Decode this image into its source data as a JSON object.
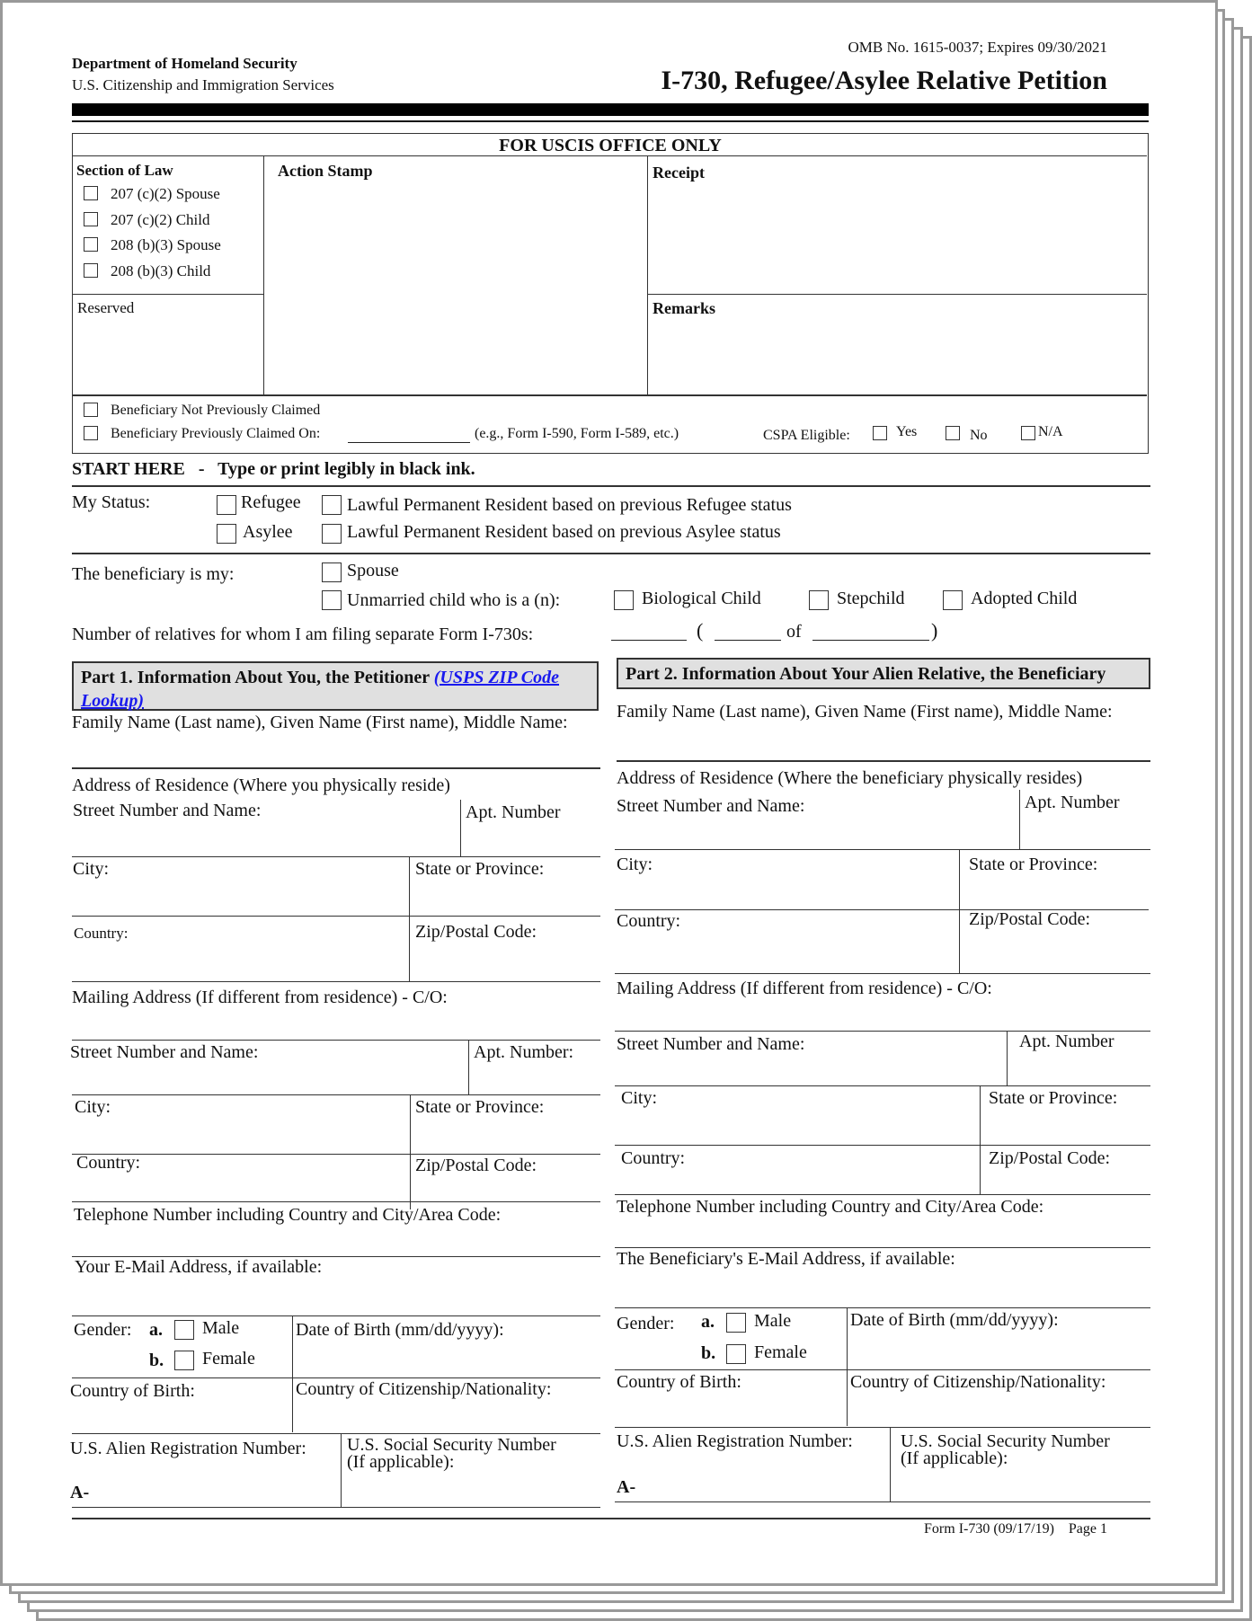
{
  "header": {
    "department": "Department of Homeland Security",
    "agency": "U.S. Citizenship and Immigration Services",
    "omb": "OMB No. 1615-0037; Expires 09/30/2021",
    "title": "I-730, Refugee/Asylee Relative Petition"
  },
  "office_use": {
    "title": "FOR USCIS OFFICE ONLY",
    "section_of_law_label": "Section of Law",
    "section_of_law_options": [
      "207 (c)(2) Spouse",
      "207 (c)(2) Child",
      "208 (b)(3) Spouse",
      "208 (b)(3) Child"
    ],
    "reserved_label": "Reserved",
    "action_stamp_label": "Action Stamp",
    "receipt_label": "Receipt",
    "remarks_label": "Remarks",
    "not_claimed_label": "Beneficiary Not Previously Claimed",
    "claimed_on_label": "Beneficiary Previously Claimed On:",
    "claimed_on_hint": "(e.g., Form I-590, Form I-589, etc.)",
    "cspa_label": "CSPA Eligible:",
    "cspa_options": [
      "Yes",
      "No",
      "N/A"
    ]
  },
  "start_here": {
    "label": "START HERE",
    "dash": "-",
    "instruction": "Type or print legibly in black ink."
  },
  "status": {
    "label": "My Status:",
    "options": [
      "Refugee",
      "Asylee",
      "Lawful Permanent Resident based on previous Refugee status",
      "Lawful Permanent Resident based on previous Asylee status"
    ]
  },
  "beneficiary_relation": {
    "label": "The beneficiary is my:",
    "spouse": "Spouse",
    "unmarried_child": "Unmarried child who is a (n):",
    "child_types": [
      "Biological Child",
      "Stepchild",
      "Adopted Child"
    ],
    "relatives_count_label": "Number of relatives for whom I am filing separate Form I-730s:",
    "open_paren": "(",
    "of": "of",
    "close_paren": ")"
  },
  "part1": {
    "title": "Part 1.  Information About You, the Petitioner ",
    "link": "(USPS ZIP Code Lookup)",
    "name_label": "Family Name (Last name), Given Name (First name), Middle Name:",
    "residence_label": "Address of Residence (Where you physically reside)",
    "street_label": "Street Number and Name:",
    "apt_label": "Apt. Number",
    "city_label": "City:",
    "state_label": "State or Province:",
    "country_label": "Country:",
    "zip_label": "Zip/Postal Code:",
    "mailing_label": "Mailing Address (If different from residence) - C/O:",
    "m_street_label": "Street Number and Name:",
    "m_apt_label": "Apt. Number:",
    "m_city_label": "City:",
    "m_state_label": "State or Province:",
    "m_country_label": "Country:",
    "m_zip_label": "Zip/Postal Code:",
    "phone_label": "Telephone Number including Country and City/Area Code:",
    "email_label": "Your E-Mail Address, if available:",
    "gender_label": "Gender:",
    "gender_a": "a.",
    "gender_b": "b.",
    "male": "Male",
    "female": "Female",
    "dob_label": "Date of Birth (mm/dd/yyyy):",
    "birth_country_label": "Country of Birth:",
    "citizenship_label": "Country of Citizenship/Nationality:",
    "alien_reg_label": "U.S. Alien Registration Number:",
    "alien_prefix": "A-",
    "ssn_label": "U.S. Social Security Number",
    "ssn_note": "(If applicable):"
  },
  "part2": {
    "title": "Part 2.  Information About Your Alien Relative, the Beneficiary",
    "name_label": "Family Name (Last name), Given Name (First name), Middle Name:",
    "residence_label": "Address of Residence (Where the beneficiary physically resides)",
    "street_label": "Street Number and Name:",
    "apt_label": "Apt. Number",
    "city_label": "City:",
    "state_label": "State or Province:",
    "country_label": "Country:",
    "zip_label": "Zip/Postal Code:",
    "mailing_label": "Mailing Address (If different from residence) - C/O:",
    "m_street_label": "Street Number and Name:",
    "m_apt_label": "Apt. Number",
    "m_city_label": "City:",
    "m_state_label": "State or Province:",
    "m_country_label": "Country:",
    "m_zip_label": "Zip/Postal Code:",
    "phone_label": "Telephone Number including Country and City/Area Code:",
    "email_label": "The Beneficiary's E-Mail Address, if available:",
    "gender_label": "Gender:",
    "gender_a": "a.",
    "gender_b": "b.",
    "male": "Male",
    "female": "Female",
    "dob_label": "Date of Birth (mm/dd/yyyy):",
    "birth_country_label": "Country of Birth:",
    "citizenship_label": "Country of Citizenship/Nationality:",
    "alien_reg_label": "U.S. Alien Registration Number:",
    "alien_prefix": "A-",
    "ssn_label": "U.S. Social Security Number",
    "ssn_note": "(If applicable):"
  },
  "footer": {
    "form_id": "Form I-730  (09/17/19)",
    "page": "Page 1"
  }
}
